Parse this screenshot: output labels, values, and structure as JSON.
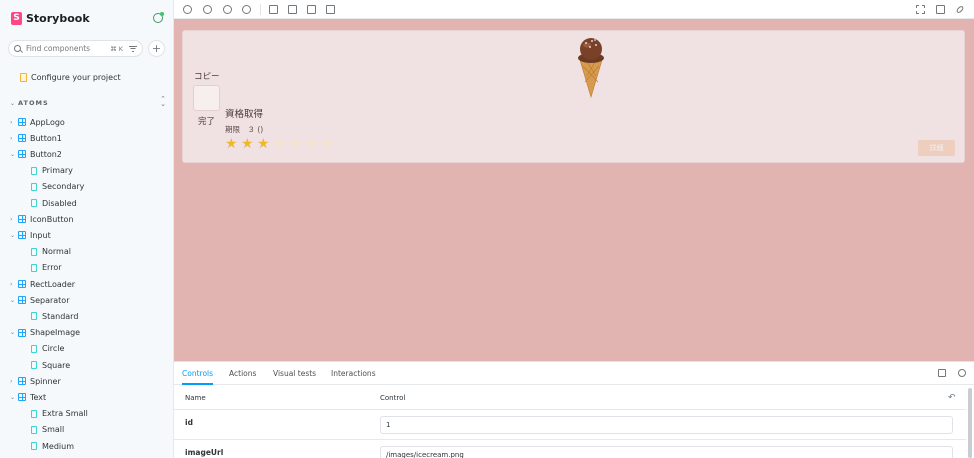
{
  "brand": {
    "name": "Storybook",
    "logo_letter": "S"
  },
  "search": {
    "placeholder": "Find components",
    "shortcut": "⌘ K"
  },
  "sidebar": {
    "configure": "Configure your project",
    "section": "ATOMS",
    "items": [
      {
        "label": "AppLogo",
        "kind": "component",
        "expanded": false
      },
      {
        "label": "Button1",
        "kind": "component",
        "expanded": false
      },
      {
        "label": "Button2",
        "kind": "component",
        "expanded": true
      },
      {
        "label": "Primary",
        "kind": "story"
      },
      {
        "label": "Secondary",
        "kind": "story"
      },
      {
        "label": "Disabled",
        "kind": "story"
      },
      {
        "label": "IconButton",
        "kind": "component",
        "expanded": false
      },
      {
        "label": "Input",
        "kind": "component",
        "expanded": true
      },
      {
        "label": "Normal",
        "kind": "story"
      },
      {
        "label": "Error",
        "kind": "story"
      },
      {
        "label": "RectLoader",
        "kind": "component",
        "expanded": false
      },
      {
        "label": "Separator",
        "kind": "component",
        "expanded": true
      },
      {
        "label": "Standard",
        "kind": "story"
      },
      {
        "label": "ShapeImage",
        "kind": "component",
        "expanded": true
      },
      {
        "label": "Circle",
        "kind": "story"
      },
      {
        "label": "Square",
        "kind": "story"
      },
      {
        "label": "Spinner",
        "kind": "component",
        "expanded": false
      },
      {
        "label": "Text",
        "kind": "component",
        "expanded": true
      },
      {
        "label": "Extra Small",
        "kind": "story"
      },
      {
        "label": "Small",
        "kind": "story"
      },
      {
        "label": "Medium",
        "kind": "story"
      }
    ]
  },
  "toolbar": {
    "icons": [
      "reload-icon",
      "zoom-in-icon",
      "zoom-out-icon",
      "zoom-reset-icon",
      "background-icon",
      "grid-icon",
      "viewport-icon",
      "measure-icon",
      "fullscreen-icon",
      "open-new-tab-icon",
      "copy-link-icon"
    ]
  },
  "preview": {
    "copy_label": "コピー",
    "done_label": "完了",
    "title": "資格取得",
    "deadline": "期限　３ ()",
    "rating": 3,
    "max_rating": 7,
    "detail_button": "詳細",
    "image_alt": "icecream",
    "colors": {
      "canvas": "#e2b4b1",
      "card": "#f0e2e2",
      "star_on": "#f2b62a",
      "star_off": "#f6e3c9",
      "detail_button": "#edcebf"
    }
  },
  "panel": {
    "tabs": [
      "Controls",
      "Actions",
      "Visual tests",
      "Interactions"
    ],
    "active_tab": "Controls",
    "columns": {
      "name": "Name",
      "control": "Control"
    },
    "rows": [
      {
        "name": "id",
        "value": "1"
      },
      {
        "name": "imageUrl",
        "value": "/images/icecream.png"
      }
    ],
    "accent": "#029cfd"
  }
}
